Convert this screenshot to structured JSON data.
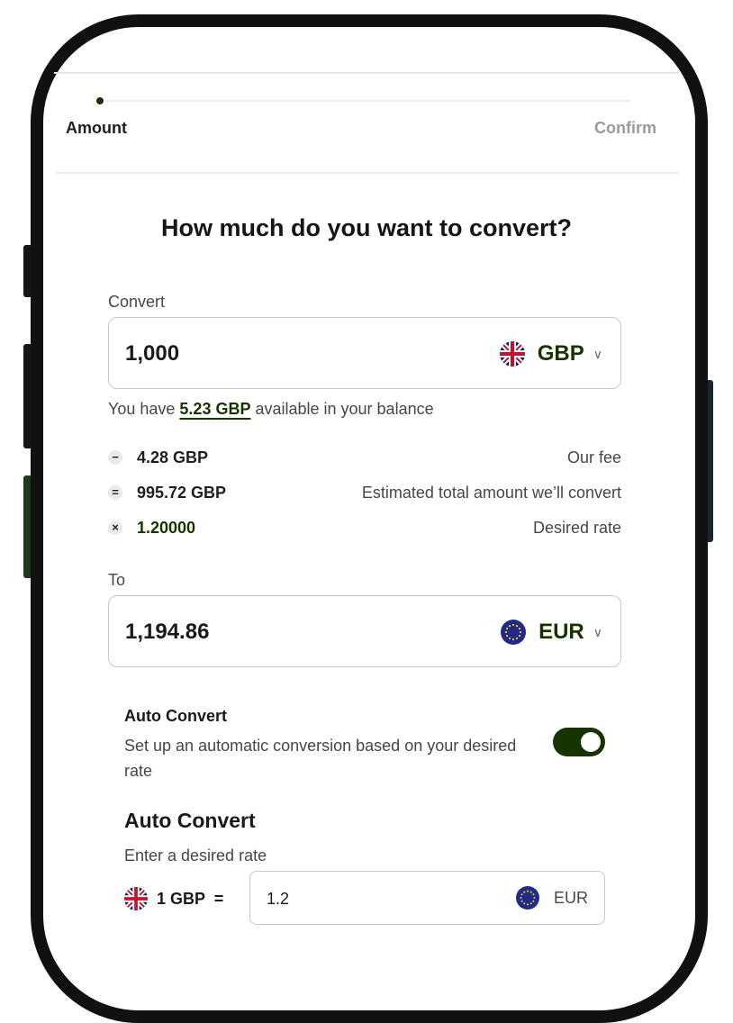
{
  "stepper": {
    "steps": [
      "Amount",
      "Confirm"
    ],
    "active": "Amount"
  },
  "title": "How much do you want to convert?",
  "convert": {
    "label": "Convert",
    "amount": "1,000",
    "currency": "GBP",
    "flag": "uk-flag-icon"
  },
  "balance": {
    "prefix": "You have ",
    "amount": "5.23 GBP",
    "suffix": " available in your balance"
  },
  "breakdown": [
    {
      "op": "−",
      "op_icon": "minus-icon",
      "value": "4.28 GBP",
      "desc": "Our fee"
    },
    {
      "op": "=",
      "op_icon": "equals-icon",
      "value": "995.72 GBP",
      "desc": "Estimated total amount we’ll convert"
    },
    {
      "op": "×",
      "op_icon": "multiply-icon",
      "value": "1.20000",
      "desc": "Desired rate"
    }
  ],
  "to": {
    "label": "To",
    "amount": "1,194.86",
    "currency": "EUR",
    "flag": "eu-flag-icon"
  },
  "auto_convert_toggle": {
    "title": "Auto Convert",
    "description": "Set up an automatic conversion based on your desired rate",
    "enabled": true
  },
  "auto_convert_rate": {
    "heading": "Auto Convert",
    "label": "Enter a desired rate",
    "base": "1 GBP  =",
    "value": "1.2",
    "currency": "EUR"
  },
  "colors": {
    "accent_dark_green": "#163300",
    "muted_text": "#454745",
    "border": "#c9c9c9"
  }
}
